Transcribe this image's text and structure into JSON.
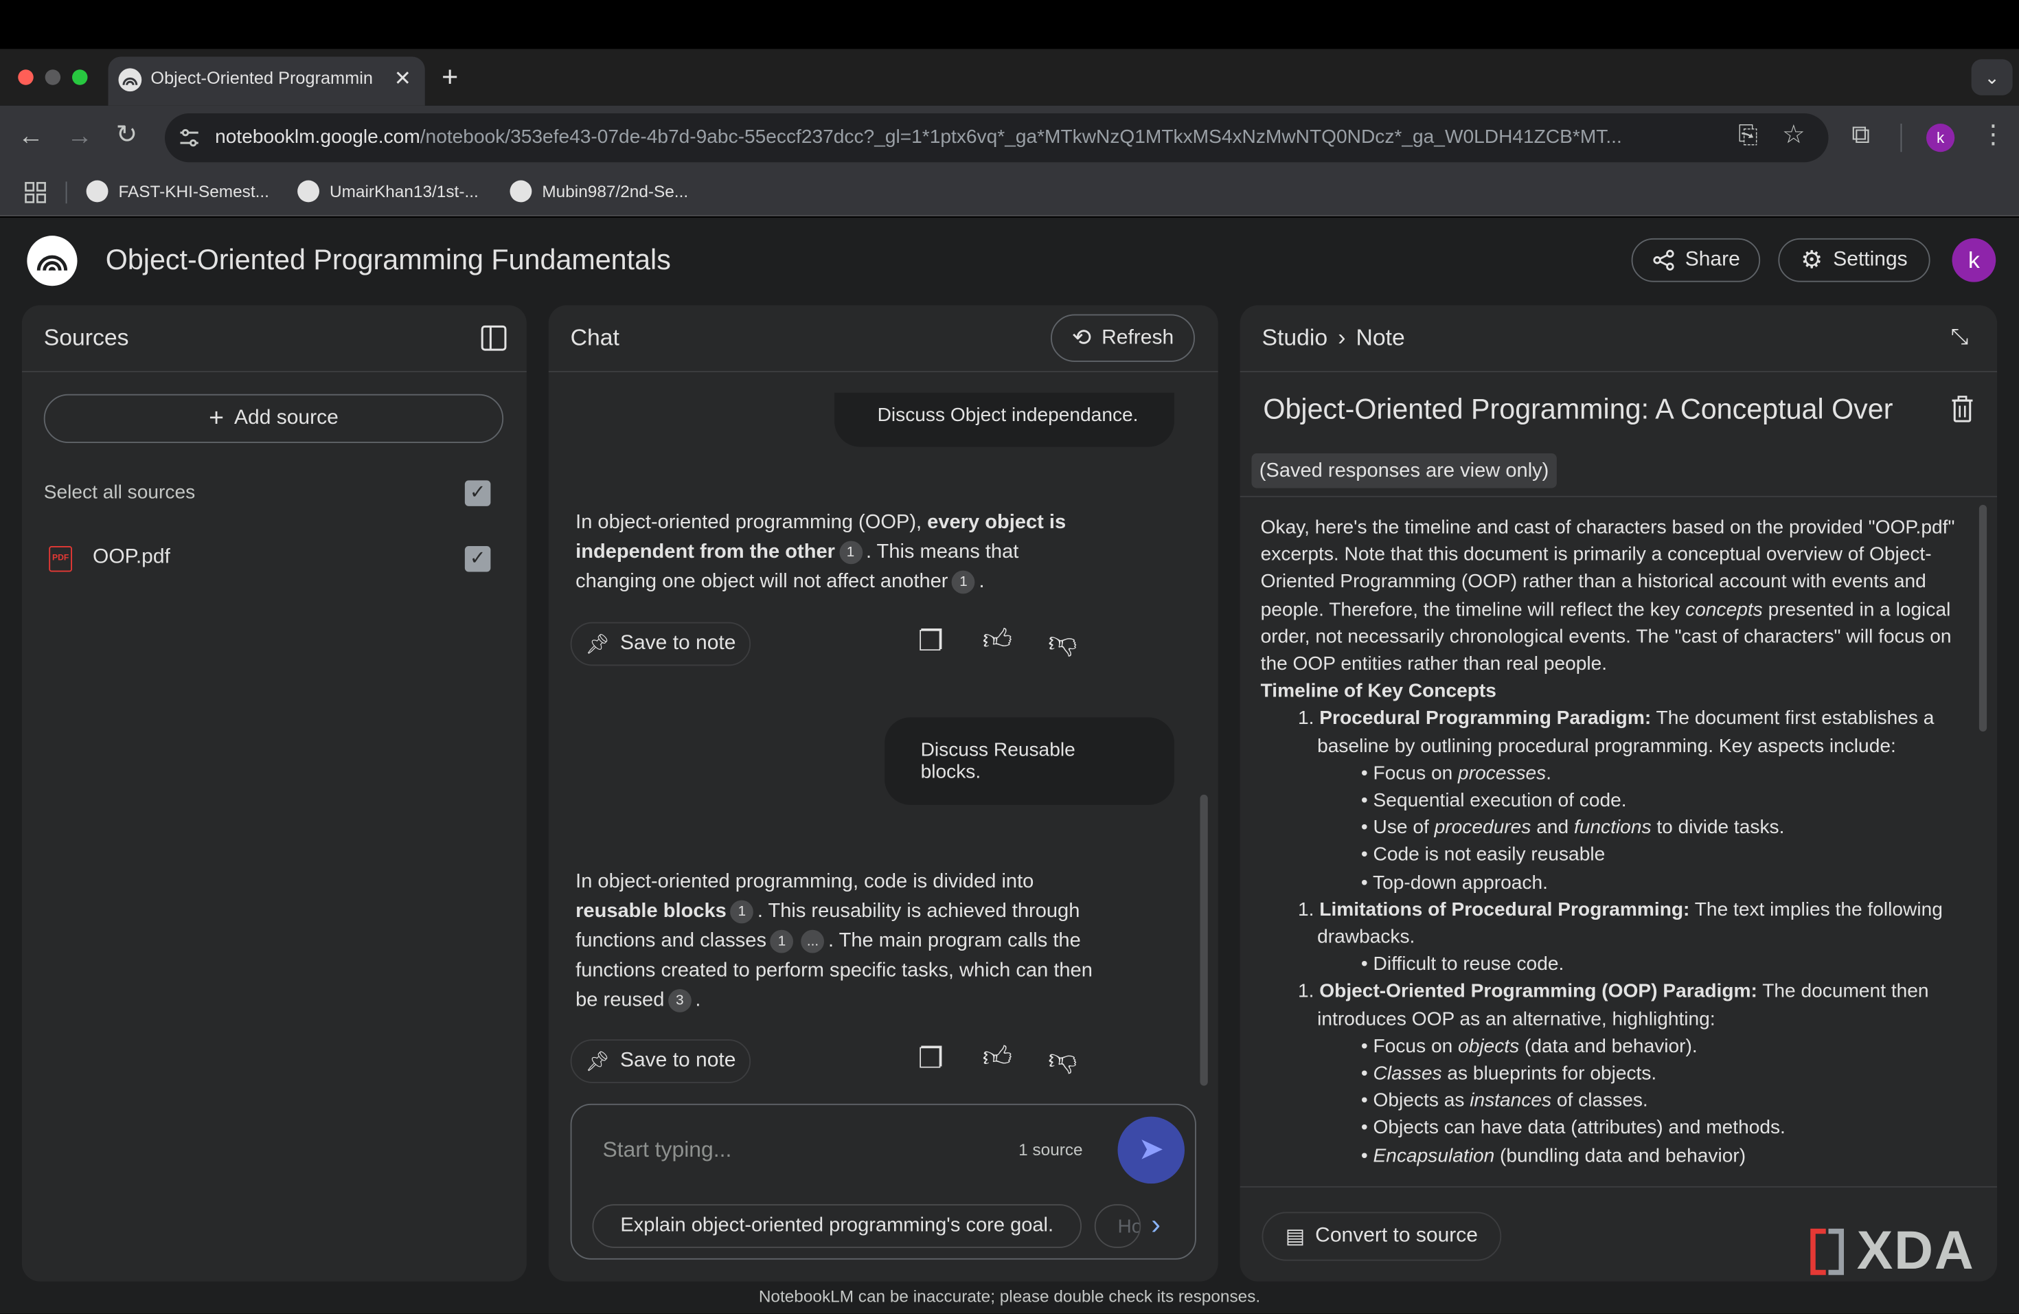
{
  "browser": {
    "tab_title": "Object-Oriented Programmin",
    "url_host": "notebooklm.google.com",
    "url_path": "/notebook/353efe43-07de-4b7d-9abc-55eccf237dcc?_gl=1*1ptx6vq*_ga*MTkwNzQ1MTkxMS4xNzMwNTQ0NDcz*_ga_W0LDH41ZCB*MT...",
    "profile_initial": "k",
    "bookmarks": [
      "FAST-KHI-Semest...",
      "UmairKhan13/1st-...",
      "Mubin987/2nd-Se..."
    ]
  },
  "app": {
    "notebook_title": "Object-Oriented Programming Fundamentals",
    "share_label": "Share",
    "settings_label": "Settings",
    "avatar_initial": "k",
    "footer_note": "NotebookLM can be inaccurate; please double check its responses.",
    "watermark": "XDA"
  },
  "sources": {
    "title": "Sources",
    "add_label": "Add source",
    "select_all_label": "Select all sources",
    "items": [
      {
        "name": "OOP.pdf",
        "type_badge": "PDF",
        "checked": true
      }
    ]
  },
  "chat": {
    "title": "Chat",
    "refresh_label": "Refresh",
    "messages": [
      {
        "role": "user",
        "text": "Discuss Object independance."
      },
      {
        "role": "assistant",
        "parts": {
          "a": "In object-oriented programming (OOP), ",
          "b": "every object is independent from the other",
          "c1": "1",
          "d": ". This means that changing one object will not affect another",
          "c2": "1",
          "e": "."
        }
      },
      {
        "role": "user",
        "text": "Discuss Reusable blocks."
      },
      {
        "role": "assistant",
        "parts": {
          "a": "In object-oriented programming, code is divided into ",
          "b": "reusable blocks",
          "c1": "1",
          "d": ". This reusability is achieved through functions and classes",
          "c2": "1",
          "c3": "...",
          "e": ". The main program calls the functions created to perform specific tasks, which can then be reused",
          "c4": "3",
          "f": "."
        }
      }
    ],
    "save_to_note_label": "Save to note",
    "input_placeholder": "Start typing...",
    "source_count": "1 source",
    "suggestion": "Explain object-oriented programming's core goal.",
    "suggestion_next": "Ho"
  },
  "studio": {
    "breadcrumb_root": "Studio",
    "breadcrumb_leaf": "Note",
    "note_title": "Object-Oriented Programming: A Conceptual Over",
    "view_only_badge": "(Saved responses are view only)",
    "intro": {
      "a": "Okay, here's the timeline and cast of characters based on the provided \"OOP.pdf\" excerpts. Note that this document is primarily a conceptual overview of Object-Oriented Programming (OOP) rather than a historical account with events and people. Therefore, the timeline will reflect the key ",
      "em": "concepts",
      "b": " presented in a logical order, not necessarily chronological events. The \"cast of characters\" will focus on the OOP entities rather than real people."
    },
    "heading": "Timeline of Key Concepts",
    "sections": [
      {
        "num": "1.",
        "bold": "Procedural Programming Paradigm:",
        "text": " The document first establishes a baseline by outlining procedural programming. Key aspects include:",
        "bullets": [
          {
            "a": "Focus on ",
            "em1": "processes",
            "b": "."
          },
          {
            "a": "Sequential execution of code."
          },
          {
            "a": "Use of ",
            "em1": "procedures",
            "b": " and ",
            "em2": "functions",
            "c": " to divide tasks."
          },
          {
            "a": "Code is not easily reusable"
          },
          {
            "a": "Top-down approach."
          }
        ]
      },
      {
        "num": "1.",
        "bold": "Limitations of Procedural Programming:",
        "text": " The text implies the following drawbacks.",
        "bullets": [
          {
            "a": "Difficult to reuse code."
          }
        ]
      },
      {
        "num": "1.",
        "bold": "Object-Oriented Programming (OOP) Paradigm:",
        "text": " The document then introduces OOP as an alternative, highlighting:",
        "bullets": [
          {
            "a": "Focus on ",
            "em1": "objects",
            "b": " (data and behavior)."
          },
          {
            "em1": "Classes",
            "b": " as blueprints for objects."
          },
          {
            "a": "Objects as ",
            "em1": "instances",
            "b": " of classes."
          },
          {
            "a": "Objects can have data (attributes) and methods."
          },
          {
            "em1": "Encapsulation",
            "b": " (bundling data and behavior)"
          }
        ]
      }
    ],
    "convert_label": "Convert to source"
  }
}
